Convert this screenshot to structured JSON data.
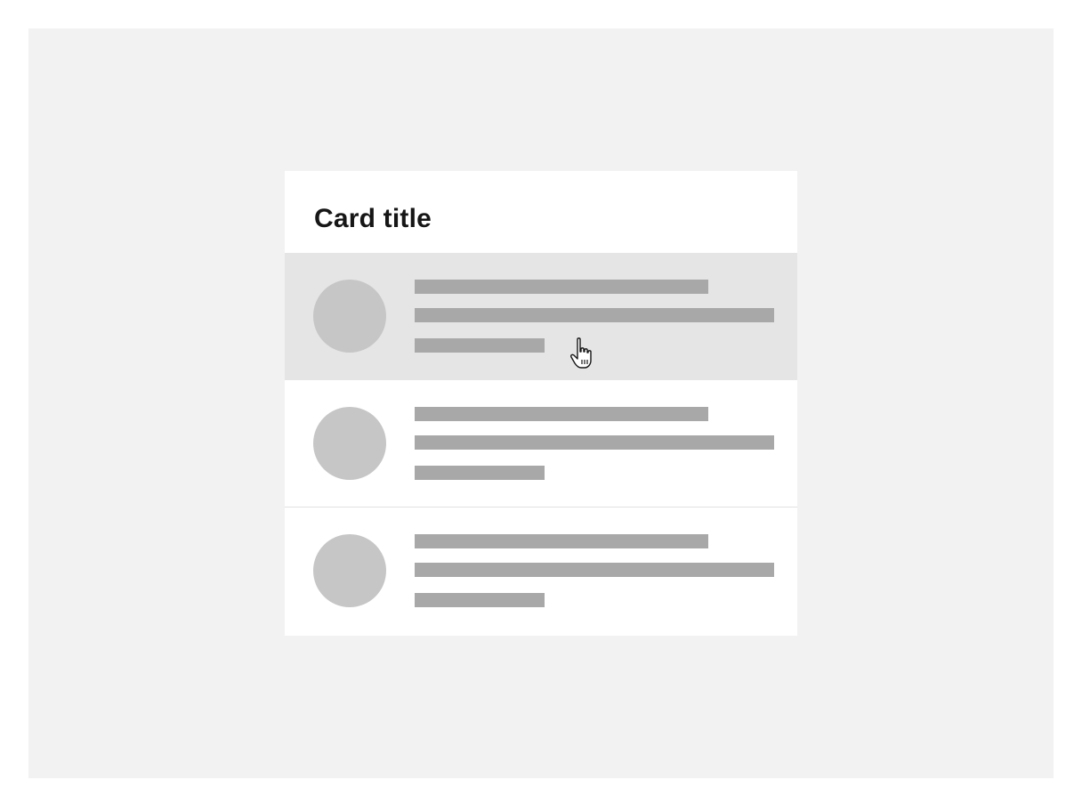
{
  "card": {
    "title": "Card title"
  },
  "list": {
    "items": [
      {
        "state": "hovered"
      },
      {
        "state": "default"
      },
      {
        "state": "default"
      }
    ]
  },
  "colors": {
    "canvas_bg": "#f2f2f2",
    "card_bg": "#ffffff",
    "hover_bg": "#e5e5e5",
    "avatar_placeholder": "#c6c6c6",
    "text_placeholder": "#a8a8a8",
    "title_text": "#161616"
  },
  "icons": {
    "cursor": "hand-pointer-cursor-icon"
  }
}
